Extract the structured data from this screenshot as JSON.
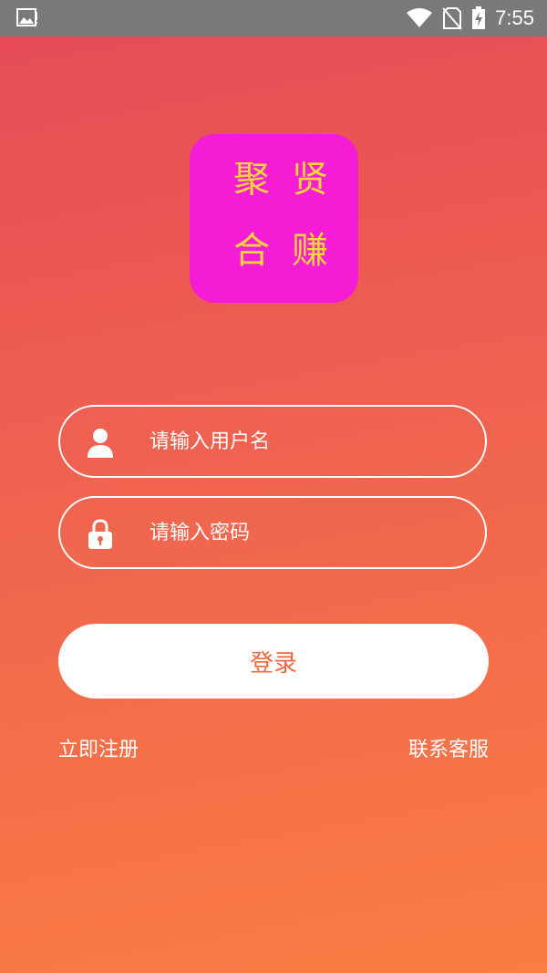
{
  "status_bar": {
    "time": "7:55",
    "icons": [
      "image-icon",
      "wifi-icon",
      "no-sim-icon",
      "battery-charging-icon"
    ]
  },
  "logo": {
    "chars": [
      "聚",
      "贤",
      "合",
      "赚"
    ],
    "background": "#f51cd6",
    "text_color": "#f5d53a"
  },
  "form": {
    "username_placeholder": "请输入用户名",
    "username_value": "",
    "password_placeholder": "请输入密码",
    "password_value": "",
    "login_label": "登录"
  },
  "links": {
    "register": "立即注册",
    "contact": "联系客服"
  },
  "colors": {
    "gradient_top": "#e64a57",
    "gradient_bottom": "#fa7d42",
    "button_text": "#f0663f"
  }
}
